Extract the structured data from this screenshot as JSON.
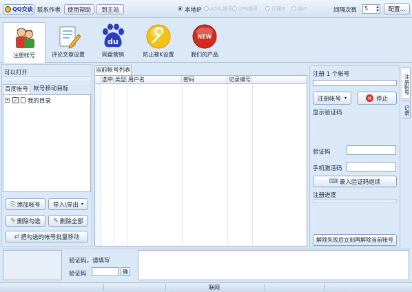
{
  "topbar": {
    "qq_button": "QQ交谈",
    "contact_author": "联系作者",
    "help": "使用帮助",
    "home": "到主站",
    "network_options": [
      {
        "label": "本地IP",
        "selected": true
      },
      {
        "label": "ADSL拨号",
        "selected": false
      },
      {
        "label": "VPN拨号",
        "selected": false
      },
      {
        "label": "代理IP",
        "selected": false
      },
      {
        "label": "换IP",
        "selected": false
      }
    ],
    "interval_label": "间隔次数",
    "interval_value": "5",
    "config_button": "配置..."
  },
  "toolbar": {
    "items": [
      {
        "label": "注册帐号",
        "icon": "users-icon",
        "active": true
      },
      {
        "label": "评论文章设置",
        "icon": "document-edit-icon",
        "active": false
      },
      {
        "label": "网盘营销",
        "icon": "baidu-paw-icon",
        "active": false
      },
      {
        "label": "防止被K设置",
        "icon": "wrench-icon",
        "active": false
      },
      {
        "label": "我们的产品",
        "icon": "new-badge-icon",
        "active": false
      }
    ],
    "baidu_logo_text": "du",
    "new_badge_text": "NEW"
  },
  "left_panel": {
    "title": "可以打开",
    "tabs": [
      "百度帐号",
      "帐号移动目标"
    ],
    "tree_root": "我的目录",
    "buttons": {
      "add": "添加帐号",
      "import_export": "导入\\导出",
      "delete_checked": "删除勾选",
      "delete_all": "删除全部",
      "move_checked": "把勾选的帐号批量移动"
    }
  },
  "center_panel": {
    "tab": "当前帐号列表",
    "columns": [
      "选中",
      "类型",
      "用户名",
      "密码",
      "记录编号"
    ]
  },
  "right_panel": {
    "register_title": "注册 1 个帐号",
    "register_button": "注册帐号",
    "stop_button": "停止",
    "captcha_display_label": "显示验证码",
    "captcha_label": "验证码",
    "captcha_value": "",
    "sms_label": "手机激活码",
    "sms_value": "",
    "submit_captcha_button": "录入验证码继续",
    "progress_label": "注册进度",
    "unlock_button": "解除失败后立刻再解除当前帐号"
  },
  "side_tabs": [
    "注册帐号",
    "记录"
  ],
  "bottom_panel": {
    "prompt": "验证码，请填写",
    "captcha_label": "验证码",
    "captcha_value": "",
    "confirm_button": "确"
  },
  "statusbar": {
    "center_text": "联网"
  },
  "colors": {
    "background": "#dbe8f7",
    "border": "#9fb3cc",
    "stop_red": "#d9302a",
    "baidu_blue": "#2a3cc8",
    "new_red": "#d42b1e",
    "wrench_yellow": "#f3c316"
  }
}
